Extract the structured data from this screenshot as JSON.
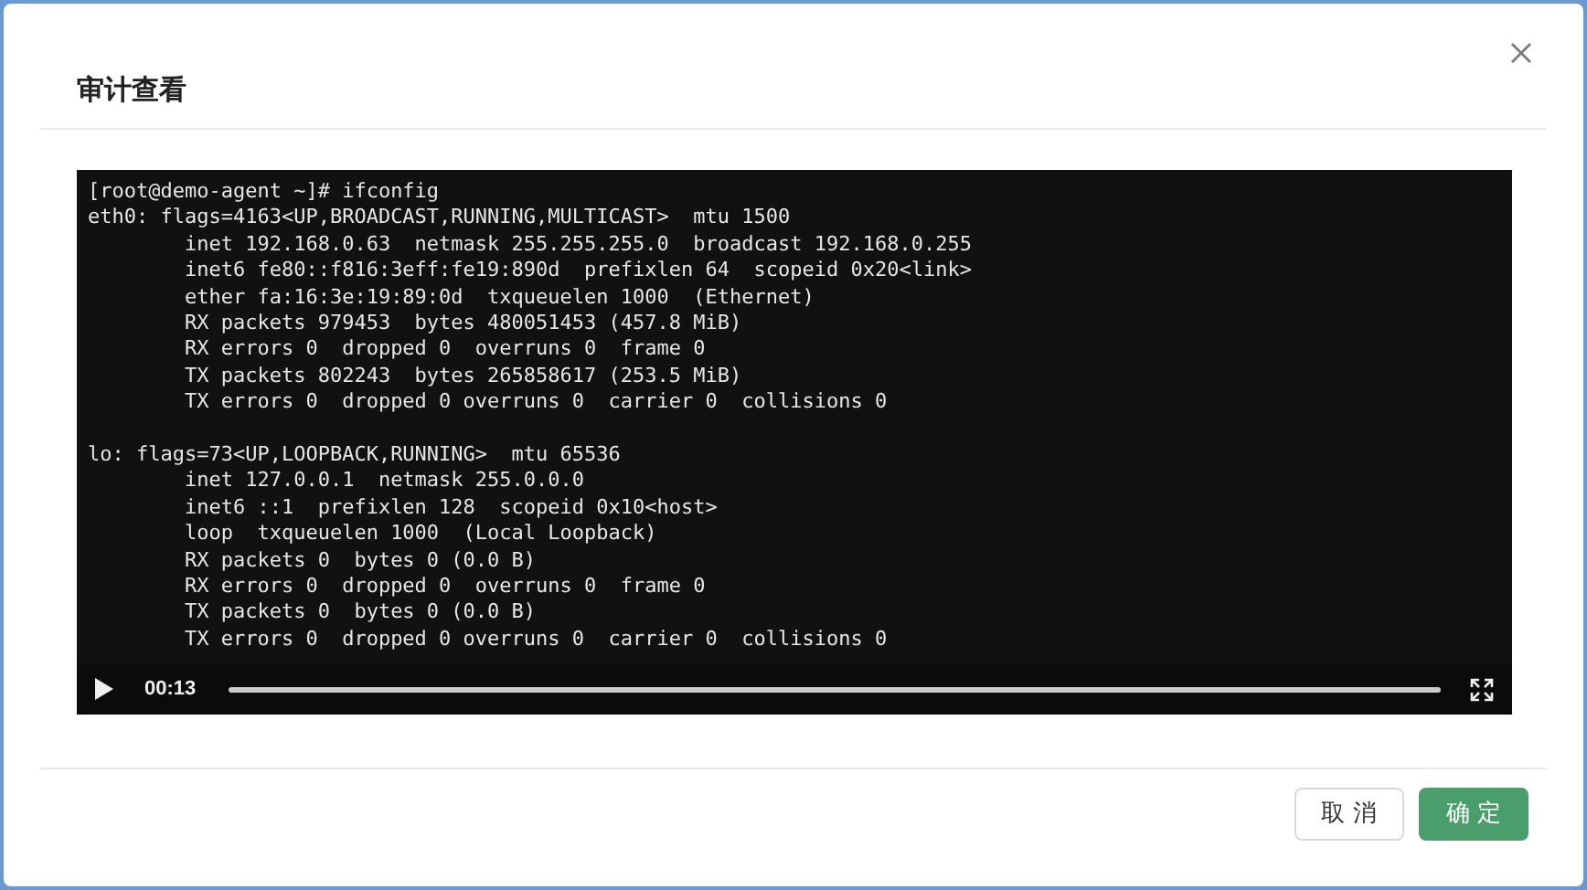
{
  "dialog": {
    "title": "审计查看"
  },
  "terminal": {
    "blocks": [
      {
        "lines": [
          "[root@demo-agent ~]# ifconfig",
          "eth0: flags=4163<UP,BROADCAST,RUNNING,MULTICAST>  mtu 1500",
          "        inet 192.168.0.63  netmask 255.255.255.0  broadcast 192.168.0.255",
          "        inet6 fe80::f816:3eff:fe19:890d  prefixlen 64  scopeid 0x20<link>",
          "        ether fa:16:3e:19:89:0d  txqueuelen 1000  (Ethernet)",
          "        RX packets 979453  bytes 480051453 (457.8 MiB)",
          "        RX errors 0  dropped 0  overruns 0  frame 0",
          "        TX packets 802243  bytes 265858617 (253.5 MiB)",
          "        TX errors 0  dropped 0 overruns 0  carrier 0  collisions 0"
        ]
      },
      {
        "lines": [
          "lo: flags=73<UP,LOOPBACK,RUNNING>  mtu 65536",
          "        inet 127.0.0.1  netmask 255.0.0.0",
          "        inet6 ::1  prefixlen 128  scopeid 0x10<host>",
          "        loop  txqueuelen 1000  (Local Loopback)",
          "        RX packets 0  bytes 0 (0.0 B)",
          "        RX errors 0  dropped 0  overruns 0  frame 0",
          "        TX packets 0  bytes 0 (0.0 B)",
          "        TX errors 0  dropped 0 overruns 0  carrier 0  collisions 0"
        ]
      }
    ]
  },
  "player": {
    "time": "00:13"
  },
  "buttons": [
    {
      "label": "取 消",
      "kind": "secondary"
    },
    {
      "label": "确 定",
      "kind": "primary"
    }
  ]
}
